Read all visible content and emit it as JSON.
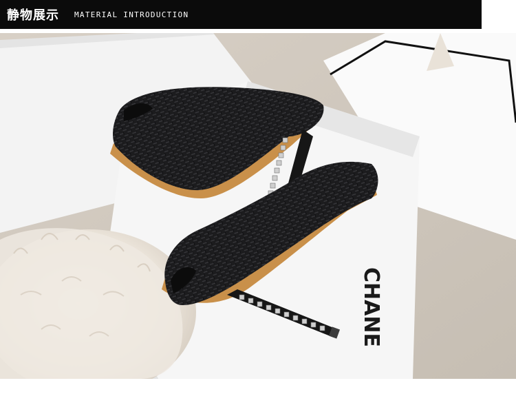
{
  "header": {
    "title": "静物展示",
    "subtitle": "MATERIAL INTRODUCTION"
  },
  "photo": {
    "box_print": "CHANE",
    "colors": {
      "header_background": "#0b0b0b",
      "header_text": "#ffffff",
      "shoe_leather": "#1c1c1e",
      "sole_trim": "#c9904a",
      "box_white": "#f2f2f2",
      "fur": "#efe9e1"
    }
  }
}
